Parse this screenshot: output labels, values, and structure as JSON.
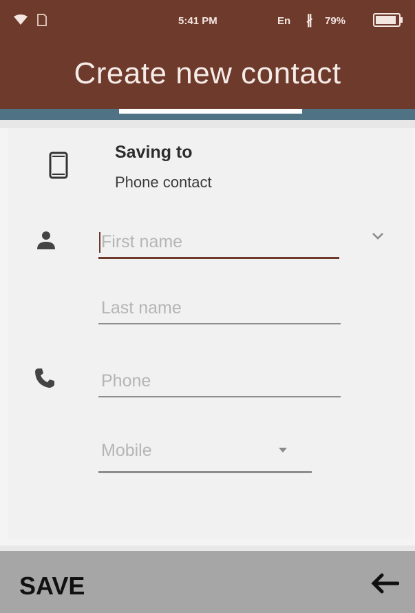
{
  "status_bar": {
    "time": "5:41 PM",
    "language": "En",
    "bluetooth_symbol": "∦",
    "battery_percent": "79%",
    "battery_level": 0.79
  },
  "header": {
    "title": "Create new contact"
  },
  "saving": {
    "title": "Saving to",
    "account": "Phone contact"
  },
  "form": {
    "first_name_placeholder": "First name",
    "last_name_placeholder": "Last name",
    "phone_placeholder": "Phone",
    "phone_type": "Mobile"
  },
  "footer": {
    "save_label": "SAVE"
  },
  "colors": {
    "brand": "#6e3a2b",
    "tab_strip": "#4f7284",
    "footer": "#a6a6a6"
  }
}
